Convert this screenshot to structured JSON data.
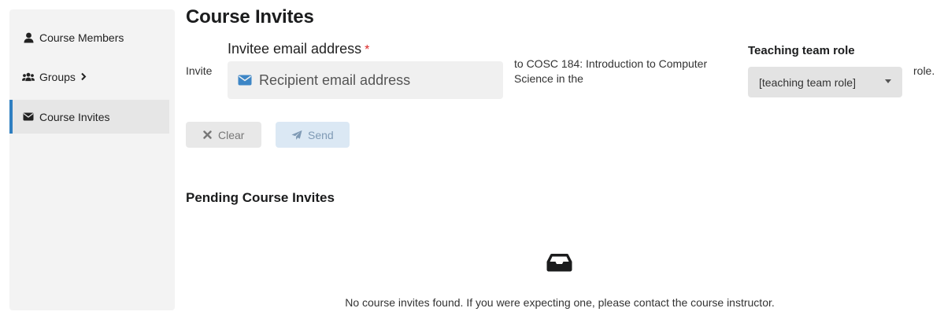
{
  "sidebar": {
    "items": [
      {
        "label": "Course Members",
        "icon": "user-icon",
        "active": false
      },
      {
        "label": "Groups",
        "icon": "users-icon",
        "active": false,
        "has_chevron": true
      },
      {
        "label": "Course Invites",
        "icon": "envelope-icon",
        "active": true
      }
    ]
  },
  "page": {
    "title": "Course Invites"
  },
  "invite_form": {
    "invite_word": "Invite",
    "email_label": "Invitee email address",
    "required_marker": "*",
    "email_placeholder": "Recipient email address",
    "email_value": "",
    "to_course_text": "to COSC 184: Introduction to Computer Science in the",
    "role_label": "Teaching team role",
    "role_selected": "[teaching team role]",
    "role_suffix": "role."
  },
  "actions": {
    "clear_label": "Clear",
    "send_label": "Send"
  },
  "pending": {
    "title": "Pending Course Invites",
    "empty_message": "No course invites found. If you were expecting one, please contact the course instructor."
  },
  "colors": {
    "accent": "#2f7fc1",
    "required": "#db2828",
    "send_bg": "#dbe8f4",
    "clear_bg": "#e8e8e8",
    "sidebar_bg": "#f3f3f3"
  }
}
